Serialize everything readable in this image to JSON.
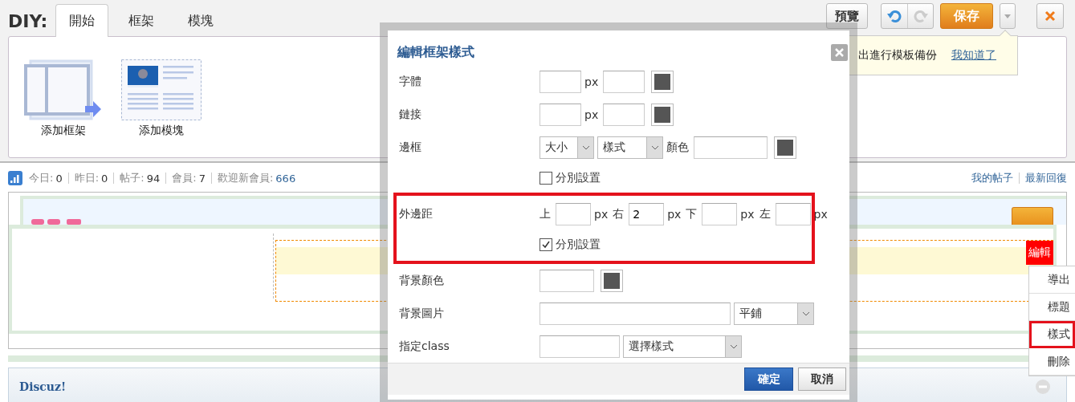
{
  "toolbar": {
    "brand": "DIY:",
    "tabs": [
      {
        "label": "開始",
        "selected": true
      },
      {
        "label": "框架",
        "selected": false
      },
      {
        "label": "模塊",
        "selected": false
      }
    ],
    "preview": "預覽",
    "undo": {
      "disabled": false
    },
    "redo": {
      "disabled": true
    },
    "save": "保存"
  },
  "tools": [
    {
      "kind": "frame",
      "label": "添加框架"
    },
    {
      "kind": "module",
      "label": "添加模塊"
    }
  ],
  "tooltip": {
    "text": "出進行模板備份",
    "link": "我知道了"
  },
  "stats": {
    "items": [
      {
        "label": "今日:",
        "value": "0"
      },
      {
        "label": "昨日:",
        "value": "0"
      },
      {
        "label": "帖子:",
        "value": "94"
      },
      {
        "label": "會員:",
        "value": "7"
      },
      {
        "label": "歡迎新會員:",
        "value": "666",
        "link": true
      }
    ],
    "links": [
      "我的帖子",
      "最新回復"
    ]
  },
  "frame": {
    "edit_label": "編輯",
    "menu": [
      {
        "label": "導出",
        "selected": false
      },
      {
        "label": "標題",
        "selected": false
      },
      {
        "label": "樣式",
        "selected": true
      },
      {
        "label": "刪除",
        "selected": false
      }
    ]
  },
  "footer": {
    "brand": "Discuz!"
  },
  "dialog": {
    "title": "編輯框架樣式",
    "rows": [
      {
        "kind": "size_color",
        "label": "字體",
        "unit": "px"
      },
      {
        "kind": "size_color",
        "label": "鏈接",
        "unit": "px"
      },
      {
        "kind": "border",
        "label": "邊框",
        "selects": [
          "大小",
          "樣式"
        ],
        "color_label": "顏色",
        "checkbox": {
          "label": "分別設置",
          "checked": false
        }
      },
      {
        "kind": "sides",
        "label": "外邊距",
        "highlighted": true,
        "sides": [
          {
            "label": "上",
            "unit": "px"
          },
          {
            "label": "右",
            "value": "2",
            "unit": "px"
          },
          {
            "label": "下",
            "unit": "px"
          },
          {
            "label": "左",
            "unit": "px"
          }
        ],
        "checkbox": {
          "label": "分別設置",
          "checked": true
        }
      },
      {
        "kind": "color",
        "label": "背景顏色"
      },
      {
        "kind": "image",
        "label": "背景圖片",
        "select": "平鋪"
      },
      {
        "kind": "class",
        "label": "指定class",
        "select": "選擇樣式"
      }
    ],
    "buttons": {
      "ok": "確定",
      "cancel": "取消"
    }
  }
}
